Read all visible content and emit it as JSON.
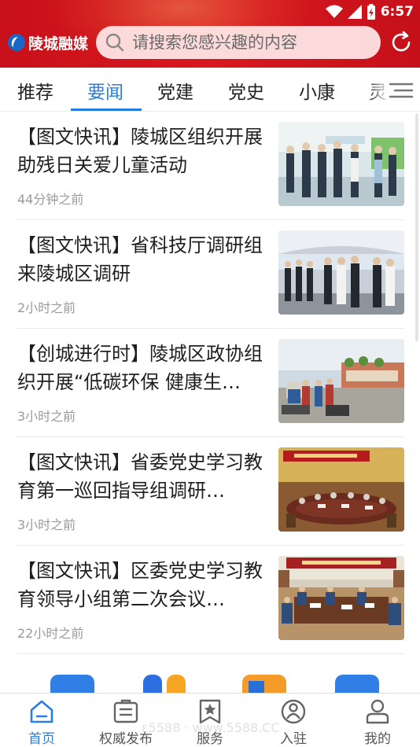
{
  "status_bar": {
    "time": "6:57"
  },
  "header": {
    "logo_text": "陵城融媒",
    "search_placeholder": "请搜索您感兴趣的内容",
    "accent_color": "#d3161d"
  },
  "tabs": [
    {
      "label": "推荐",
      "active": false
    },
    {
      "label": "要闻",
      "active": true
    },
    {
      "label": "党建",
      "active": false
    },
    {
      "label": "党史",
      "active": false
    },
    {
      "label": "小康",
      "active": false
    },
    {
      "label": "灵",
      "active": false
    }
  ],
  "news": [
    {
      "title": "【图文快讯】陵城区组织开展助残日关爱儿童活动",
      "time": "44分钟之前"
    },
    {
      "title": "【图文快讯】省科技厅调研组来陵城区调研",
      "time": "2小时之前"
    },
    {
      "title": "【创城进行时】陵城区政协组织开展“低碳环保 健康生…",
      "time": "3小时之前"
    },
    {
      "title": "【图文快讯】省委党史学习教育第一巡回指导组调研…",
      "time": "3小时之前"
    },
    {
      "title": "【图文快讯】区委党史学习教育领导小组第二次会议…",
      "time": "22小时之前"
    }
  ],
  "bottom_nav": [
    {
      "label": "首页",
      "icon": "home-icon",
      "active": true
    },
    {
      "label": "权威发布",
      "icon": "release-icon",
      "active": false
    },
    {
      "label": "服务",
      "icon": "service-icon",
      "active": false
    },
    {
      "label": "入驻",
      "icon": "join-icon",
      "active": false
    },
    {
      "label": "我的",
      "icon": "profile-icon",
      "active": false
    }
  ],
  "watermark": "ε5588 · www.5588.CC",
  "colors": {
    "active_blue": "#2a7ee0",
    "header_red": "#d3161d"
  }
}
